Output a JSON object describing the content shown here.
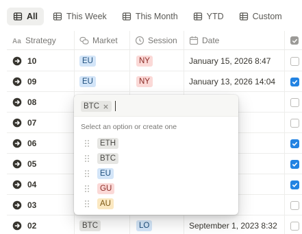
{
  "tabs": [
    {
      "label": "All",
      "icon": "table-icon",
      "active": true
    },
    {
      "label": "This Week",
      "icon": "table-icon",
      "active": false
    },
    {
      "label": "This Month",
      "icon": "table-icon",
      "active": false
    },
    {
      "label": "YTD",
      "icon": "table-icon",
      "active": false
    },
    {
      "label": "Custom",
      "icon": "table-icon",
      "active": false
    }
  ],
  "columns": {
    "strategy": "Strategy",
    "market": "Market",
    "session": "Session",
    "date": "Date"
  },
  "rows": [
    {
      "strategy": "10",
      "market": "EU",
      "session": "NY",
      "date": "January 15, 2026 8:47",
      "checked": false
    },
    {
      "strategy": "09",
      "market": "EU",
      "session": "NY",
      "date": "January 13, 2026 14:04",
      "checked": true
    },
    {
      "strategy": "08",
      "market": "",
      "session": "",
      "date": "026 16:44",
      "checked": false
    },
    {
      "strategy": "07",
      "market": "",
      "session": "",
      "date": "026 8:32",
      "checked": false
    },
    {
      "strategy": "06",
      "market": "",
      "session": "",
      "date": "026 10:23",
      "checked": true
    },
    {
      "strategy": "05",
      "market": "",
      "session": "",
      "date": ", 2023 8:47",
      "checked": true
    },
    {
      "strategy": "04",
      "market": "",
      "session": "",
      "date": "2023 14:04",
      "checked": true
    },
    {
      "strategy": "03",
      "market": "",
      "session": "",
      "date": "2023 16:44",
      "checked": false
    },
    {
      "strategy": "02",
      "market": "BTC",
      "session": "LO",
      "date": "September 1, 2023 8:32",
      "checked": false
    }
  ],
  "popup": {
    "selected_chip": "BTC",
    "hint": "Select an option or create one",
    "options": [
      "ETH",
      "BTC",
      "EU",
      "GU",
      "AU"
    ]
  },
  "colors": {
    "accent": "#2383e2",
    "tag_blue": "#d3e5f8",
    "tag_red": "#fbd9d7",
    "tag_gray": "#e6e6e3",
    "tag_yellow": "#fbe8c1"
  }
}
